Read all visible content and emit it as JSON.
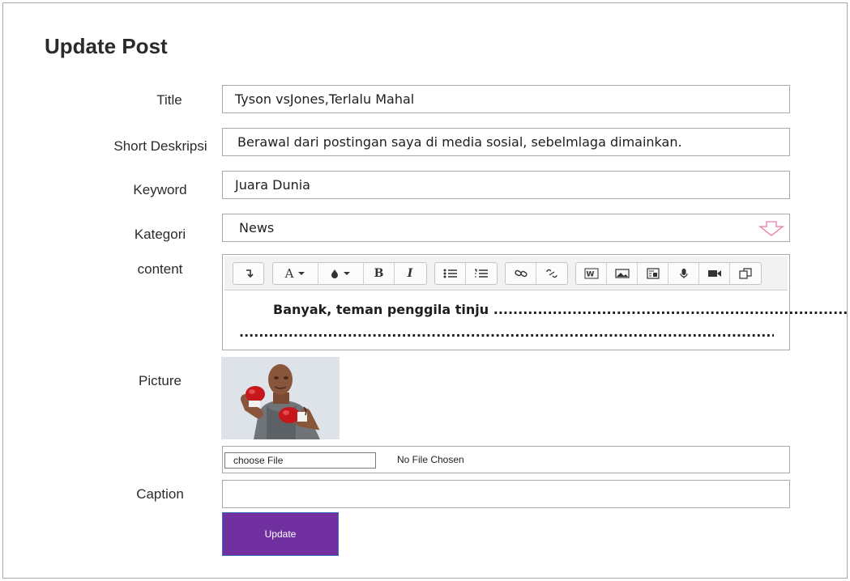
{
  "page": {
    "title": "Update Post"
  },
  "form": {
    "title": {
      "label": "Title",
      "value": "Tyson vsJones,Terlalu Mahal"
    },
    "short_desc": {
      "label": "Short Deskripsi",
      "value": "Berawal dari postingan saya di media sosial, sebelmlaga dimainkan."
    },
    "keyword": {
      "label": "Keyword",
      "value": "Juara Dunia"
    },
    "kategori": {
      "label": "Kategori",
      "value": "News"
    },
    "content": {
      "label": "content",
      "line1": "Banyak, teman penggila tinju ........................................................................",
      "line2": "......................................................................................................................................."
    },
    "picture": {
      "label": "Picture",
      "choose_label": "choose File",
      "no_file": "No File Chosen"
    },
    "caption": {
      "label": "Caption",
      "value": ""
    },
    "submit": {
      "label": "Update"
    }
  },
  "toolbar": {
    "icons": [
      "undo-icon",
      "font-color-icon",
      "highlight-icon",
      "bold-icon",
      "italic-icon",
      "bullet-list-icon",
      "numbered-list-icon",
      "link-icon",
      "unlink-icon",
      "word-icon",
      "image-icon",
      "media-icon",
      "mic-icon",
      "video-icon",
      "paste-icon"
    ],
    "bold": "B",
    "italic": "I",
    "font": "A"
  },
  "colors": {
    "update_button": "#7030a0",
    "select_arrow": "#e87aa8"
  }
}
